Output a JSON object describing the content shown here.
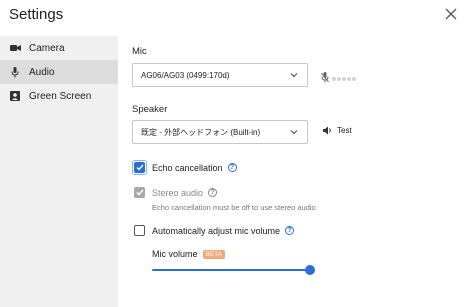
{
  "window": {
    "title": "Settings"
  },
  "sidebar": {
    "items": [
      {
        "label": "Camera",
        "icon": "camera-icon"
      },
      {
        "label": "Audio",
        "icon": "mic-icon",
        "active": true
      },
      {
        "label": "Green Screen",
        "icon": "person-icon"
      }
    ]
  },
  "mic": {
    "label": "Mic",
    "selected": "AG06/AG03 (0499:170d)"
  },
  "speaker": {
    "label": "Speaker",
    "selected": "既定 - 外部ヘッドフォン (Built-in)",
    "test_label": "Test"
  },
  "options": {
    "echo_cancellation": {
      "label": "Echo cancellation",
      "checked": true
    },
    "stereo_audio": {
      "label": "Stereo audio",
      "checked": true,
      "disabled": true,
      "hint": "Echo cancellation must be off to use stereo audio"
    },
    "auto_adjust": {
      "label": "Automatically adjust mic volume",
      "checked": false
    }
  },
  "mic_volume": {
    "label": "Mic volume",
    "badge": "BETA",
    "value": 1.0
  },
  "colors": {
    "accent": "#2b6fd6",
    "beta": "#f0a97a",
    "sidebar_bg": "#f0f0f0",
    "sidebar_active": "#dcdcdc"
  }
}
